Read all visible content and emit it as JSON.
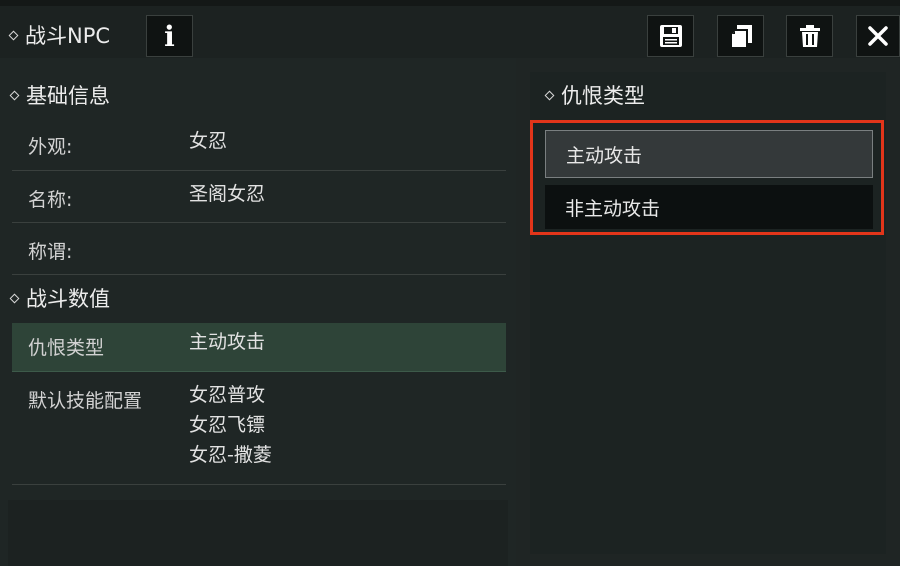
{
  "window": {
    "title": "战斗NPC",
    "info_icon": "info-icon",
    "actions": [
      {
        "name": "save",
        "icon": "save-icon"
      },
      {
        "name": "copy",
        "icon": "copy-icon"
      },
      {
        "name": "delete",
        "icon": "trash-icon"
      },
      {
        "name": "close",
        "icon": "close-icon"
      }
    ]
  },
  "basic_info": {
    "title": "基础信息",
    "rows": [
      {
        "label": "外观:",
        "value": "女忍"
      },
      {
        "label": "名称:",
        "value": "圣阁女忍"
      },
      {
        "label": "称谓:",
        "value": ""
      }
    ]
  },
  "combat_values": {
    "title": "战斗数值",
    "aggro": {
      "label": "仇恨类型",
      "value": "主动攻击"
    },
    "skills": {
      "label": "默认技能配置",
      "values": [
        "女忍普攻",
        "女忍飞镖",
        "女忍-撒菱"
      ]
    }
  },
  "aggro_panel": {
    "title": "仇恨类型",
    "options": [
      "主动攻击",
      "非主动攻击"
    ],
    "selected": "主动攻击",
    "highlight_color": "#e2351a"
  }
}
